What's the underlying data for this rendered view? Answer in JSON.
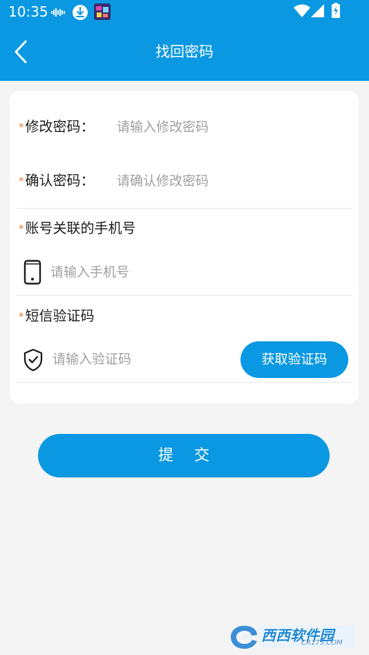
{
  "status_bar": {
    "time": "10:35",
    "icons": [
      "audio-wave-icon",
      "download-icon",
      "app-thumbnail-icon",
      "wifi-icon",
      "cellular-signal-icon",
      "battery-charging-icon"
    ]
  },
  "nav": {
    "title": "找回密码",
    "back_icon": "back-arrow-icon"
  },
  "form": {
    "new_password": {
      "required_mark": "*",
      "label": "修改密码：",
      "placeholder": "请输入修改密码",
      "value": ""
    },
    "confirm_password": {
      "required_mark": "*",
      "label": "确认密码：",
      "placeholder": "请确认修改密码",
      "value": ""
    },
    "phone": {
      "required_mark": "*",
      "label": "账号关联的手机号",
      "icon": "mobile-phone-icon",
      "placeholder": "请输入手机号",
      "value": ""
    },
    "sms_code": {
      "required_mark": "*",
      "label": "短信验证码",
      "icon": "shield-check-icon",
      "placeholder": "请输入验证码",
      "value": "",
      "get_code_label": "获取验证码"
    },
    "submit_label": "提交"
  },
  "watermark": {
    "text": "西西软件园",
    "url": "CR173.COM"
  },
  "colors": {
    "accent": "#0a98e2",
    "required": "#ef7f2d",
    "background": "#f4f4f4",
    "placeholder": "#9f9f9f"
  }
}
